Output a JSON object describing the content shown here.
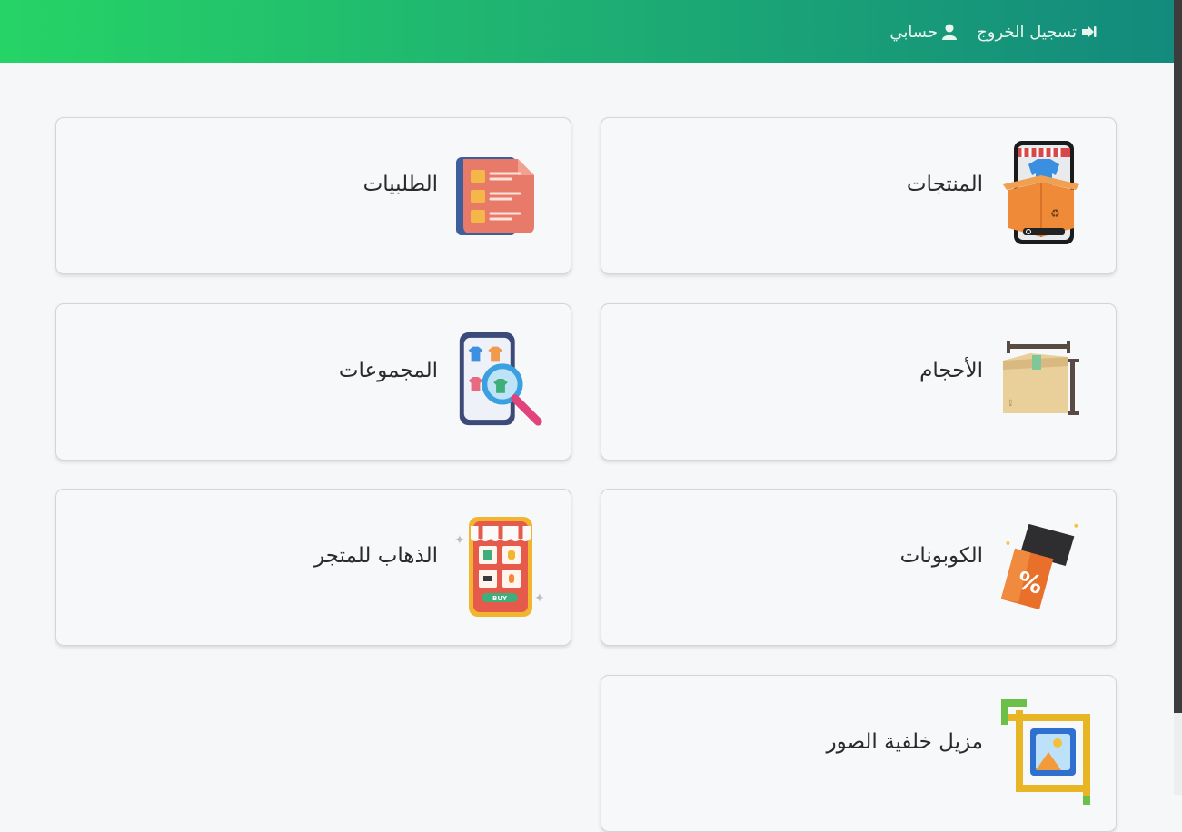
{
  "header": {
    "logout_label": "تسجيل الخروج",
    "account_label": "حسابي",
    "gradient_colors": [
      "#26d466",
      "#138a7d"
    ]
  },
  "cards": [
    {
      "label": "المنتجات",
      "icon": "product-box-phone-icon"
    },
    {
      "label": "الطلبيات",
      "icon": "order-list-icon"
    },
    {
      "label": "الأحجام",
      "icon": "size-box-icon"
    },
    {
      "label": "المجموعات",
      "icon": "collections-search-icon"
    },
    {
      "label": "الكوبونات",
      "icon": "coupon-icon"
    },
    {
      "label": "الذهاب للمتجر",
      "icon": "shop-phone-icon"
    },
    {
      "label": "مزيل خلفية الصور",
      "icon": "image-crop-icon"
    }
  ],
  "shop_icon_text": "BUY"
}
